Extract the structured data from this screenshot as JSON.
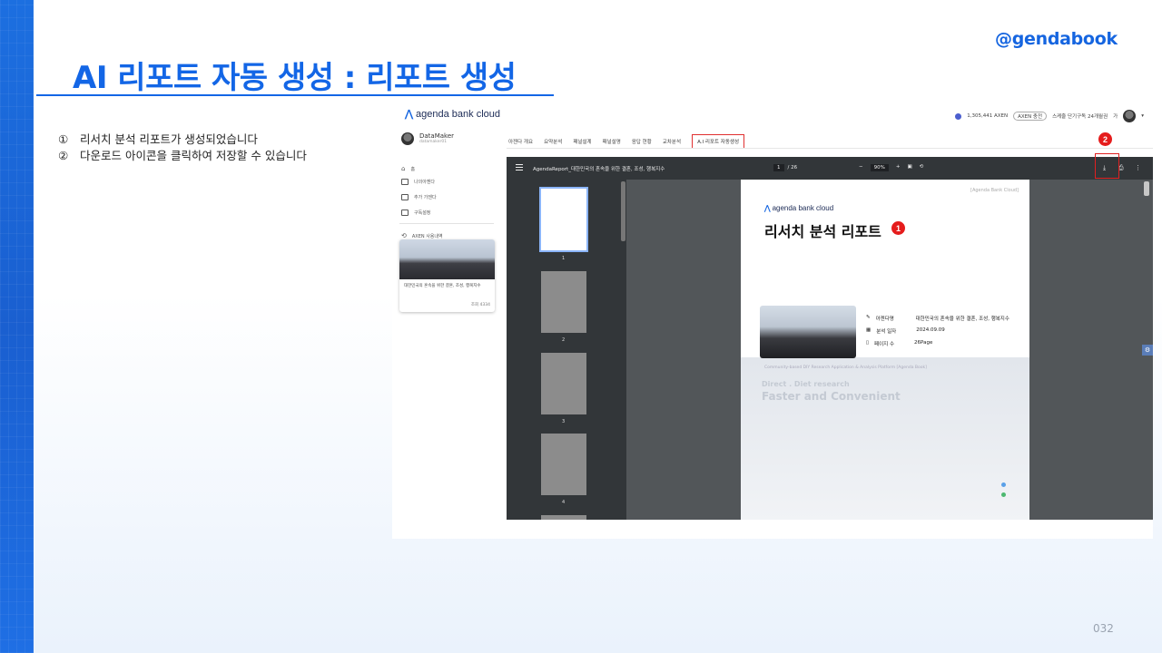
{
  "brand": "@gendabook",
  "title": "AI 리포트 자동 생성 : 리포트 생성",
  "steps": [
    {
      "num": "①",
      "text": "리서치 분석 리포트가 생성되었습니다"
    },
    {
      "num": "②",
      "text": "다운로드 아이콘을 클릭하여 저장할 수 있습니다"
    }
  ],
  "page_number": "032",
  "app": {
    "logo": "agenda bank cloud",
    "header_right": {
      "coins": "1,305,441 AXEN",
      "coin_pill": "AXEN 충전",
      "plan": "스케줄 단기구독 24개월권",
      "lang": "가",
      "more": "▾"
    },
    "profile": {
      "name": "DataMaker",
      "sub": "datamaker01"
    },
    "sidebar_items": [
      "홈",
      "나의아젠다",
      "추가 가젠다",
      "구독설정",
      "AXEN 사용내역"
    ],
    "card": {
      "text": "대한민국의 혼속을 위한 결혼, 조성, 행복지수",
      "count": "조회 4334"
    },
    "tabs": [
      "아젠다 개요",
      "요약분석",
      "패널설계",
      "패널설명",
      "응답 현황",
      "교차분석",
      "A.I 리포트 자동생성"
    ],
    "viewer": {
      "filename": "AgendaReport_대한민국의 혼속을 위한 결혼, 조성, 행복지수",
      "page_current": "1",
      "page_total": "/ 26",
      "zoom": "90%",
      "thumb_labels": [
        "1",
        "2",
        "3",
        "4"
      ]
    },
    "report": {
      "source": "[Agenda Bank Cloud]",
      "logo": "agenda bank cloud",
      "title": "리서치 분석 리포트",
      "meta": [
        {
          "key": "아젠다명",
          "value": "대한민국의 혼속을 위한 결혼, 조성, 행복지수"
        },
        {
          "key": "분석 일자",
          "value": "2024.09.09"
        },
        {
          "key": "페이지 수",
          "value": "26Page"
        }
      ],
      "tagline": "Community-based DIY Research Application & Analysis Platform [Agenda Book]",
      "slogan1": "Direct . Diet research",
      "slogan2": "Faster and Convenient"
    },
    "badges": [
      "1",
      "2"
    ]
  },
  "colors": {
    "accent": "#1366e6",
    "highlight": "#e02020"
  }
}
